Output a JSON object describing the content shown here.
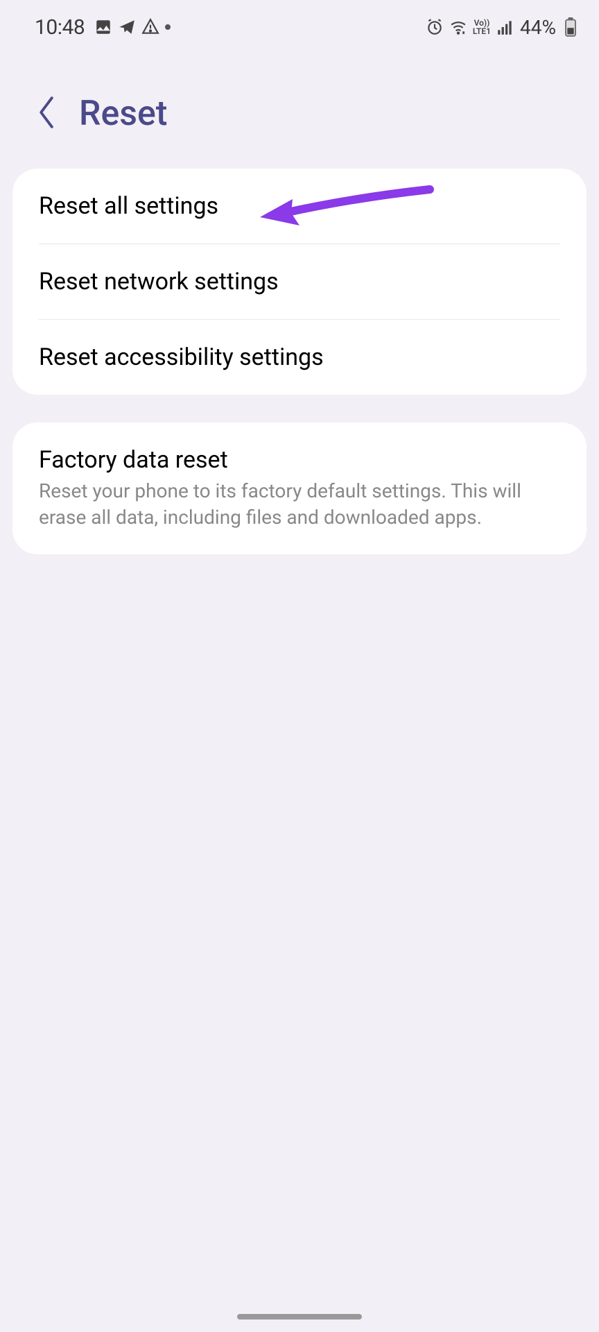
{
  "statusBar": {
    "time": "10:48",
    "batteryText": "44%",
    "icons": {
      "imageIcon": "image-icon",
      "telegramIcon": "telegram-icon",
      "warningIcon": "warning-icon",
      "alarmIcon": "alarm-icon",
      "wifiIcon": "wifi-icon",
      "volteTop": "Vo))",
      "volteBottom": "LTE1",
      "signalIcon": "signal-icon",
      "batteryIcon": "battery-icon"
    }
  },
  "header": {
    "title": "Reset"
  },
  "groups": [
    {
      "items": [
        {
          "label": "Reset all settings"
        },
        {
          "label": "Reset network settings"
        },
        {
          "label": "Reset accessibility settings"
        }
      ]
    },
    {
      "items": [
        {
          "label": "Factory data reset",
          "subtitle": "Reset your phone to its factory default settings. This will erase all data, including files and downloaded apps."
        }
      ]
    }
  ]
}
